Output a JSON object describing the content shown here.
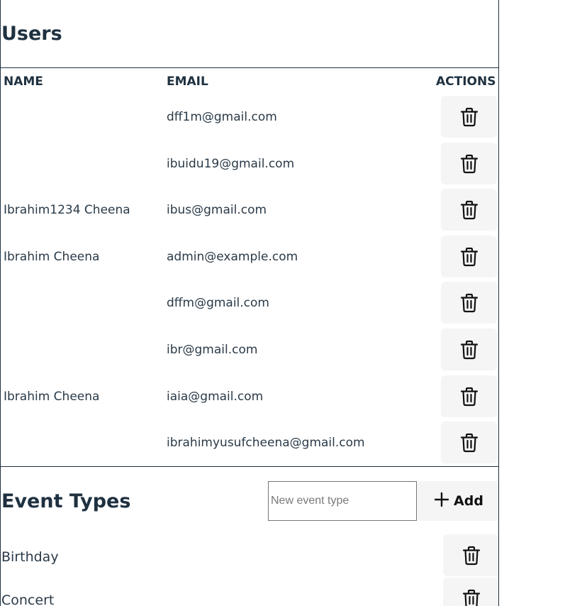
{
  "users_section": {
    "title": "Users",
    "columns": {
      "name": "NAME",
      "email": "EMAIL",
      "actions": "ACTIONS"
    },
    "rows": [
      {
        "name": "",
        "email": "dff1m@gmail.com"
      },
      {
        "name": "",
        "email": "ibuidu19@gmail.com"
      },
      {
        "name": "Ibrahim1234 Cheena",
        "email": "ibus@gmail.com"
      },
      {
        "name": "Ibrahim Cheena",
        "email": "admin@example.com"
      },
      {
        "name": "",
        "email": "dffm@gmail.com"
      },
      {
        "name": "",
        "email": "ibr@gmail.com"
      },
      {
        "name": "Ibrahim Cheena",
        "email": "iaia@gmail.com"
      },
      {
        "name": "",
        "email": "ibrahimyusufcheena@gmail.com"
      }
    ],
    "delete_icon": "trash-icon"
  },
  "event_types_section": {
    "title": "Event Types",
    "input": {
      "placeholder": "New event type",
      "value": ""
    },
    "add_button": {
      "label": "Add",
      "icon": "plus-icon"
    },
    "items": [
      {
        "name": "Birthday"
      },
      {
        "name": "Concert"
      }
    ],
    "delete_icon": "trash-icon"
  },
  "colors": {
    "text": "#1f3140",
    "border": "#1f3140",
    "button_bg": "#f5f5f5"
  }
}
